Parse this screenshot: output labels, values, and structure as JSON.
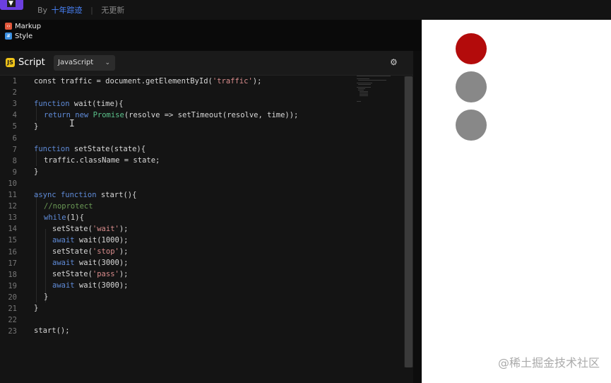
{
  "header": {
    "by_label": "By",
    "author": "十年踪迹",
    "updated": "无更新"
  },
  "files": [
    {
      "name": "Markup",
      "icon": "markup-icon"
    },
    {
      "name": "Style",
      "icon": "style-icon"
    }
  ],
  "script_panel": {
    "title": "Script",
    "badge": "JS",
    "language": "JavaScript",
    "settings_icon": "gear-icon"
  },
  "code_lines": [
    "1",
    "2",
    "3",
    "4",
    "5",
    "6",
    "7",
    "8",
    "9",
    "10",
    "11",
    "12",
    "13",
    "14",
    "15",
    "16",
    "17",
    "18",
    "19",
    "20",
    "21",
    "22",
    "23"
  ],
  "code": {
    "l1a": "const traffic = document.getElementById(",
    "l1b": "'traffic'",
    "l1c": ");",
    "l3a": "function",
    "l3b": " wait(time){",
    "l4a": "return",
    "l4b": "new",
    "l4c": "Promise",
    "l4d": "(resolve => setTimeout(resolve, time));",
    "l5": "}",
    "l7a": "function",
    "l7b": " setState(state){",
    "l8": "traffic.className = state;",
    "l9": "}",
    "l11a": "async",
    "l11b": "function",
    "l11c": " start(){",
    "l12": "//noprotect",
    "l13a": "while",
    "l13b": "(1){",
    "l14a": "setState(",
    "l14b": "'wait'",
    "l14c": ");",
    "l15a": "await",
    "l15b": " wait(1000);",
    "l16a": "setState(",
    "l16b": "'stop'",
    "l16c": ");",
    "l17a": "await",
    "l17b": " wait(3000);",
    "l18a": "setState(",
    "l18b": "'pass'",
    "l18c": ");",
    "l19a": "await",
    "l19b": " wait(3000);",
    "l20": "}",
    "l21": "}",
    "l23": "start();"
  },
  "preview": {
    "lights": [
      {
        "name": "red-light",
        "color": "#b30b0b"
      },
      {
        "name": "middle-light",
        "color": "#888888"
      },
      {
        "name": "bottom-light",
        "color": "#888888"
      }
    ],
    "watermark": "@稀土掘金技术社区"
  },
  "colors": {
    "accent": "#6c3fe0",
    "author_link": "#4a86ff",
    "keyword": "#5f8bd8",
    "string": "#d98c8c"
  }
}
